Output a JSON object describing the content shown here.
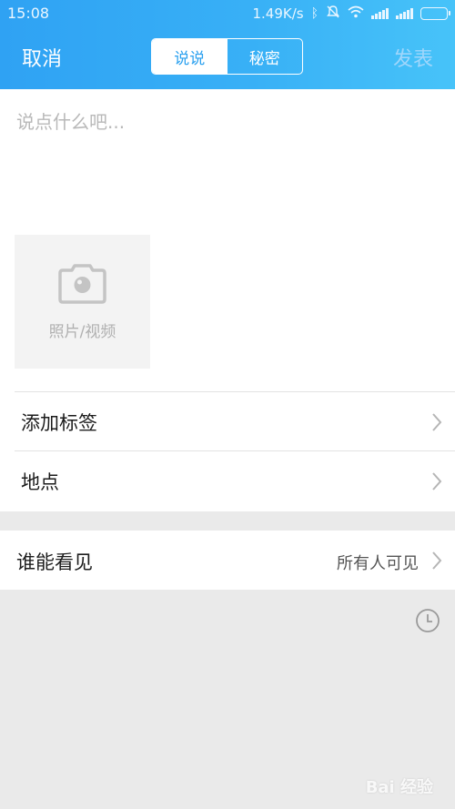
{
  "status_bar": {
    "time": "15:08",
    "speed": "1.49K/s"
  },
  "header": {
    "cancel_label": "取消",
    "publish_label": "发表",
    "segments": [
      {
        "label": "说说",
        "active": true
      },
      {
        "label": "秘密",
        "active": false
      }
    ]
  },
  "editor": {
    "placeholder": "说点什么吧..."
  },
  "media": {
    "label": "照片/视频",
    "icon": "camera-icon"
  },
  "options": [
    {
      "label": "添加标签"
    },
    {
      "label": "地点"
    }
  ],
  "visibility": {
    "label": "谁能看见",
    "value": "所有人可见"
  },
  "watermark": "Bai 经验",
  "colors": {
    "accent": "#2fa2f3",
    "header_gradient_end": "#47c3f9",
    "background": "#eaeaea"
  }
}
